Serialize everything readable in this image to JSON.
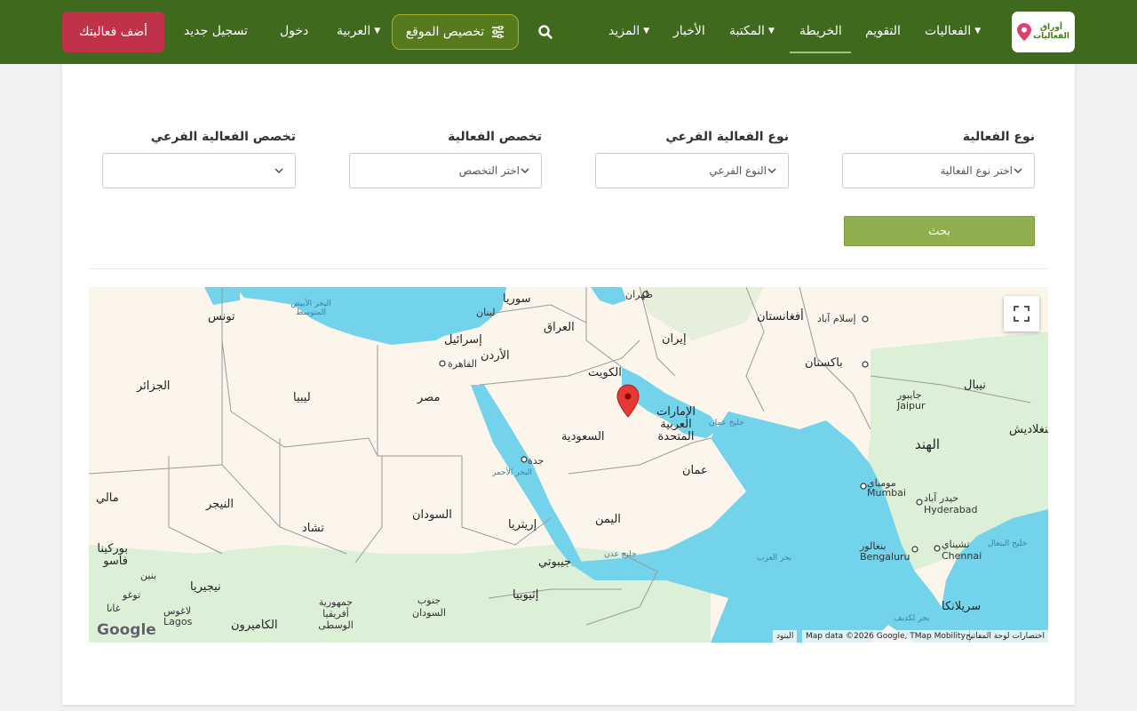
{
  "header": {
    "logo_text_line1": "أوراق",
    "logo_text_line2": "الفعاليات",
    "nav": {
      "events": "الفعاليات",
      "calendar": "التقويم",
      "map": "الخريطة",
      "library": "المكتبة",
      "news": "الأخبار",
      "more": "المزيد",
      "language": "العربية",
      "login": "دخول",
      "register": "تسجيل جديد"
    },
    "customize_label": "تخصيص الموقع",
    "add_event_label": "أضف فعاليتك",
    "search_icon": "search-icon",
    "customize_icon": "sliders-icon"
  },
  "filters": {
    "event_type": {
      "label": "نوع الفعالية",
      "value": "اختر نوع الفعالية"
    },
    "event_subtype": {
      "label": "نوع الفعالية الفرعي",
      "value": "النوع الفرعي"
    },
    "specialty": {
      "label": "تخصص الفعالية",
      "value": "اختر التخصص"
    },
    "sub_specialty": {
      "label": "تخصص الفعالية الفرعي",
      "value": ""
    },
    "search_button": "بحث"
  },
  "map": {
    "labels": {
      "syria": "سوريا",
      "lebanon": "لبنان",
      "iraq": "العراق",
      "tehran": "طهران",
      "afghanistan": "أفغانستان",
      "islamabad": "إسلام آباد",
      "tunisia": "تونس",
      "med_sea": "البحر الأبيض المتوسط",
      "israel": "إسرائيل",
      "jordan": "الأردن",
      "iran": "إيران",
      "pakistan": "باكستان",
      "cairo": "القاهرة",
      "kuwait": "الكويت",
      "algeria": "الجزائر",
      "libya": "ليبيا",
      "egypt": "مصر",
      "nepal": "نيبال",
      "jaipur_ar": "جايبور",
      "jaipur": "Jaipur",
      "uae": "الإمارات العربية المتحدة",
      "gulf_oman": "خليج عمان",
      "saudi": "السعودية",
      "india": "الهند",
      "jeddah": "جدة",
      "red_sea": "البحر الأحمر",
      "oman": "عمان",
      "bangladesh": "بنغلاديش",
      "mali": "مالي",
      "niger": "النيجر",
      "mumbai_ar": "مومباي",
      "mumbai": "Mumbai",
      "hyderabad_ar": "حيدر آباد",
      "hyderabad": "Hyderabad",
      "sudan": "السودان",
      "yemen": "اليمن",
      "chad": "تشاد",
      "eritrea": "إريتريا",
      "burkina": "بوركينا فاسو",
      "gulf_aden": "خليج عدن",
      "arabian_sea": "بحر العرب",
      "bengaluru_ar": "بنغالور",
      "bengaluru": "Bengaluru",
      "chennai_ar": "تشيناي",
      "chennai": "Chennai",
      "bay_bengal": "خليج البنغال",
      "djibouti": "جيبوتي",
      "benin": "بنين",
      "nigeria": "نيجيريا",
      "ethiopia": "إثيوبيا",
      "togo": "توغو",
      "ghana": "غانا",
      "cameroon": "الكاميرون",
      "car": "جمهورية أفريقيا الوسطى",
      "south_sudan": "جنوب السودان",
      "sri_lanka": "سريلانكا",
      "lagos_ar": "لاغوس",
      "lagos": "Lagos",
      "laccadive": "بحر لكديف",
      "google": "Google"
    },
    "attribution": {
      "shortcuts": "اختصارات لوحة المفاتيح",
      "data": "Map data ©2026 Google, TMap Mobility",
      "terms": "البنود"
    },
    "fullscreen_icon": "fullscreen-icon",
    "marker_icon": "map-marker-icon",
    "colors": {
      "land": "#fbf5ec",
      "water": "#72d3ea",
      "green": "#dcefd7",
      "marker": "#e53935"
    }
  }
}
